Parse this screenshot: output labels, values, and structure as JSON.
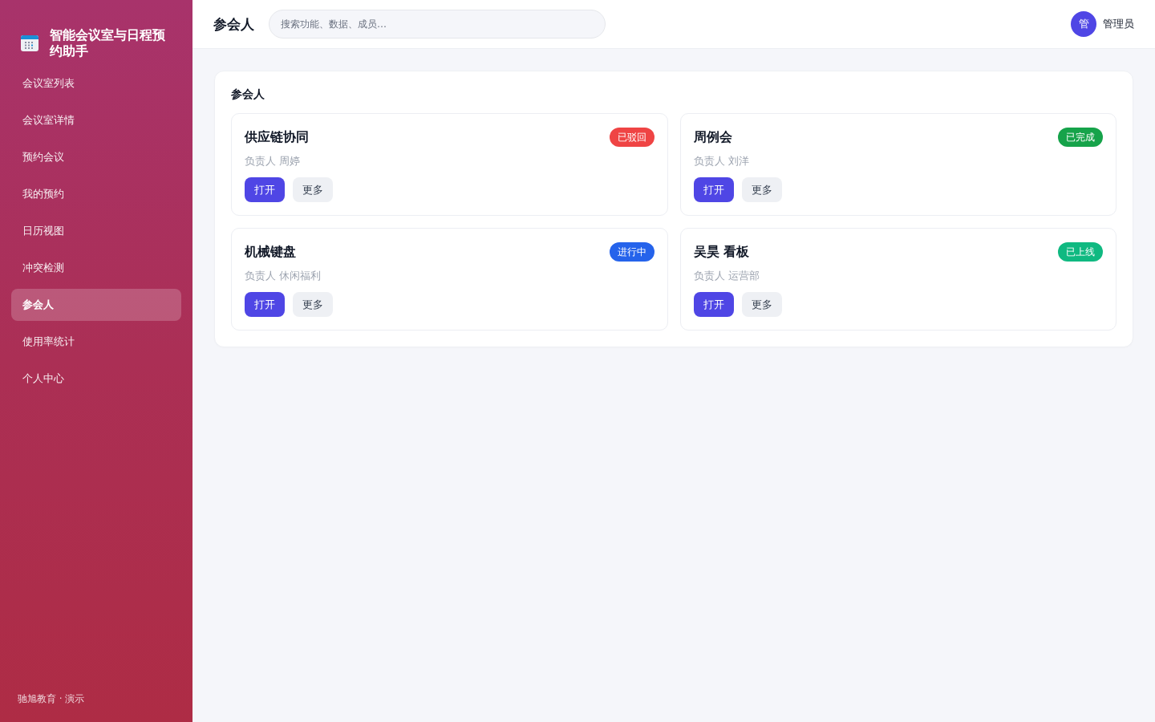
{
  "sidebar": {
    "title": "智能会议室与日程预约助手",
    "items": [
      {
        "label": "会议室列表",
        "selected": false
      },
      {
        "label": "会议室详情",
        "selected": false
      },
      {
        "label": "预约会议",
        "selected": false
      },
      {
        "label": "我的预约",
        "selected": false
      },
      {
        "label": "日历视图",
        "selected": false
      },
      {
        "label": "冲突检测",
        "selected": false
      },
      {
        "label": "参会人",
        "selected": true
      },
      {
        "label": "使用率统计",
        "selected": false
      },
      {
        "label": "个人中心",
        "selected": false
      }
    ],
    "footer": "驰旭教育 · 演示"
  },
  "header": {
    "title": "参会人",
    "search": {
      "placeholder": "搜索功能、数据、成员…"
    },
    "user": {
      "avatar": "管",
      "name": "管理员"
    }
  },
  "panel": {
    "title": "参会人",
    "cards": [
      {
        "title": "供应链协同",
        "status": "已驳回",
        "color": "#ef4444",
        "owner": "负责人 周婷",
        "buttons": [
          {
            "label": "打开",
            "kind": "primary"
          },
          {
            "label": "更多",
            "kind": "secondary"
          }
        ]
      },
      {
        "title": "周例会",
        "status": "已完成",
        "color": "#16a34a",
        "owner": "负责人 刘洋",
        "buttons": [
          {
            "label": "打开",
            "kind": "primary"
          },
          {
            "label": "更多",
            "kind": "secondary"
          }
        ]
      },
      {
        "title": "机械键盘",
        "status": "进行中",
        "color": "#2563eb",
        "owner": "负责人 休闲福利",
        "buttons": [
          {
            "label": "打开",
            "kind": "primary"
          },
          {
            "label": "更多",
            "kind": "secondary"
          }
        ]
      },
      {
        "title": "吴昊 看板",
        "status": "已上线",
        "color": "#10b981",
        "owner": "负责人 运营部",
        "buttons": [
          {
            "label": "打开",
            "kind": "primary"
          },
          {
            "label": "更多",
            "kind": "secondary"
          }
        ]
      }
    ]
  }
}
